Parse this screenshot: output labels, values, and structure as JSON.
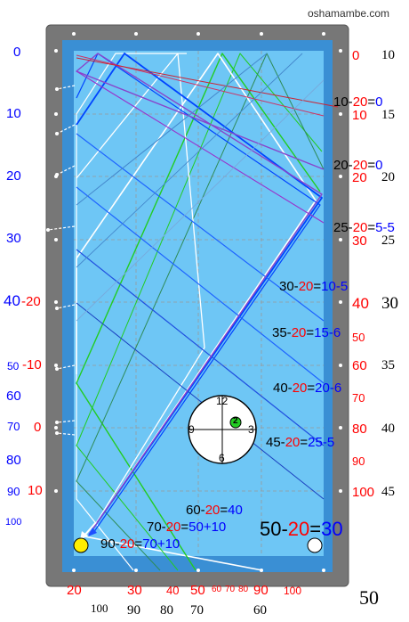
{
  "site": "oshamambe.com",
  "left_scale": {
    "blue": [
      "0",
      "10",
      "20",
      "30",
      "40",
      "50",
      "60",
      "70",
      "80",
      "90",
      "100"
    ],
    "red": [
      "-20",
      "-10",
      "0",
      "10"
    ]
  },
  "right_scale": {
    "red": [
      "0",
      "10",
      "20",
      "30",
      "40",
      "50",
      "60",
      "70",
      "80",
      "90",
      "100"
    ],
    "black": [
      "10",
      "15",
      "20",
      "25",
      "30",
      "35",
      "40",
      "45"
    ]
  },
  "bottom_scale": {
    "red": [
      "20",
      "30",
      "40",
      "50",
      "60",
      "70",
      "80",
      "90",
      "100"
    ],
    "black": [
      "100",
      "90",
      "80",
      "70",
      "60",
      "50"
    ]
  },
  "equations": [
    {
      "a": "10-",
      "b": "20",
      "c": "=",
      "d": "0"
    },
    {
      "a": "20-",
      "b": "20",
      "c": "=",
      "d": "0"
    },
    {
      "a": "25-",
      "b": "20",
      "c": "=",
      "d": "5-5"
    },
    {
      "a": "30-",
      "b": "20",
      "c": "=",
      "d": "10-5"
    },
    {
      "a": "35-",
      "b": "20",
      "c": "=",
      "d": "15-6"
    },
    {
      "a": "40-",
      "b": "20",
      "c": "=",
      "d": "20-6"
    },
    {
      "a": "45-",
      "b": "20",
      "c": "=",
      "d": "25-5"
    },
    {
      "a": "60-",
      "b": "20",
      "c": "=",
      "d": "40"
    },
    {
      "a": "70-",
      "b": "20",
      "c": "=",
      "d": "50+10"
    },
    {
      "a": "90-",
      "b": "20",
      "c": "=",
      "d": "70+10"
    },
    {
      "a": "50-",
      "b": "20",
      "c": "=",
      "d": "30"
    }
  ],
  "clock": {
    "n12": "12",
    "n3": "3",
    "n6": "6",
    "n9": "9",
    "ball": "2"
  },
  "colors": {
    "rail": "#777777",
    "cushion": "#3a8fd4",
    "cloth": "#6ec6f5",
    "cue_ball": "#ffee00",
    "object_ball": "#ffffff",
    "ball2": "#22cc22"
  }
}
